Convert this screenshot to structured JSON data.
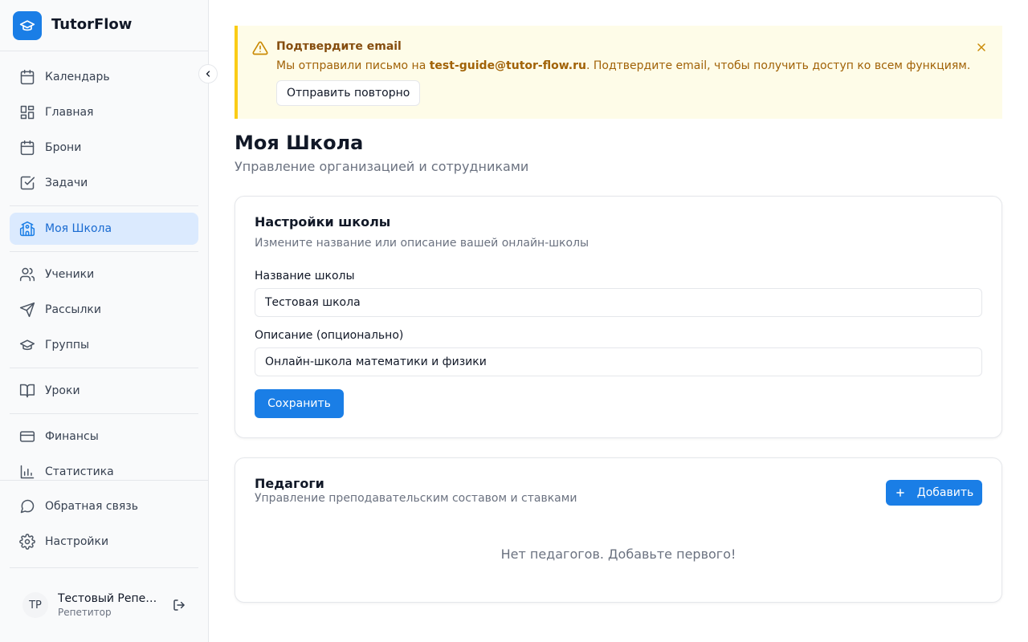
{
  "app": {
    "name": "TutorFlow"
  },
  "sidebar": {
    "items": [
      {
        "label": "Календарь",
        "icon": "calendar-icon"
      },
      {
        "label": "Главная",
        "icon": "dashboard-icon"
      },
      {
        "label": "Брони",
        "icon": "calendar-icon"
      },
      {
        "label": "Задачи",
        "icon": "checkbox-icon"
      },
      {
        "label": "Моя Школа",
        "icon": "school-icon",
        "active": true
      },
      {
        "label": "Ученики",
        "icon": "users-icon"
      },
      {
        "label": "Рассылки",
        "icon": "send-icon"
      },
      {
        "label": "Группы",
        "icon": "graduation-cap-icon"
      },
      {
        "label": "Уроки",
        "icon": "book-icon"
      },
      {
        "label": "Финансы",
        "icon": "credit-card-icon"
      },
      {
        "label": "Статистика",
        "icon": "bar-chart-icon"
      },
      {
        "label": "Обратная связь",
        "icon": "message-circle-icon"
      },
      {
        "label": "Настройки",
        "icon": "gear-icon"
      }
    ]
  },
  "user": {
    "initials": "ТР",
    "name": "Тестовый Репетитор",
    "role": "Репетитор"
  },
  "alert": {
    "title": "Подтвердите email",
    "text_before": "Мы отправили письмо на ",
    "email": "test-guide@tutor-flow.ru",
    "text_after": ". Подтвердите email, чтобы получить доступ ко всем функциям.",
    "resend_label": "Отправить повторно"
  },
  "page": {
    "title": "Моя Школа",
    "subtitle": "Управление организацией и сотрудниками"
  },
  "settings_card": {
    "title": "Настройки школы",
    "description": "Измените название или описание вашей онлайн-школы",
    "name_label": "Название школы",
    "name_value": "Тестовая школа",
    "desc_label": "Описание (опционально)",
    "desc_value": "Онлайн-школа математики и физики",
    "save_label": "Сохранить"
  },
  "teachers_card": {
    "title": "Педагоги",
    "description": "Управление преподавательским составом и ставками",
    "add_label": "Добавить",
    "empty_text": "Нет педагогов. Добавьте первого!"
  },
  "colors": {
    "accent": "#1a7ee6",
    "active_bg": "#dbeafe",
    "warning_bg": "#fefce8",
    "warning_border": "#facc15"
  }
}
